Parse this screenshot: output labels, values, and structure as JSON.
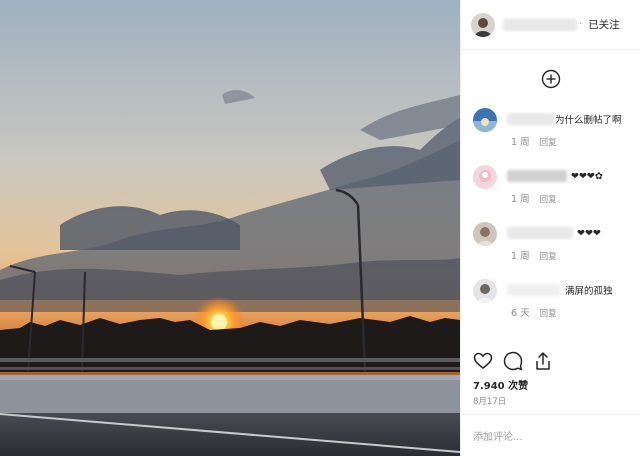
{
  "header": {
    "follow_label": "已关注",
    "separator": "·"
  },
  "comments": [
    {
      "text": "为什么删帖了啊",
      "time": "1 周",
      "reply": "回复"
    },
    {
      "text": "❤❤❤✿",
      "time": "1 周",
      "reply": "回复"
    },
    {
      "text": "❤❤❤",
      "time": "1 周",
      "reply": "回复"
    },
    {
      "text": "满屏的孤独",
      "time": "6 天",
      "reply": "回复"
    }
  ],
  "post": {
    "likes": "7.940 次赞",
    "date": "8月17日"
  },
  "composer": {
    "placeholder": "添加评论..."
  },
  "icons": {
    "add": "plus-circle-icon",
    "like": "heart-icon",
    "comment": "comment-bubble-icon",
    "share": "share-icon"
  }
}
